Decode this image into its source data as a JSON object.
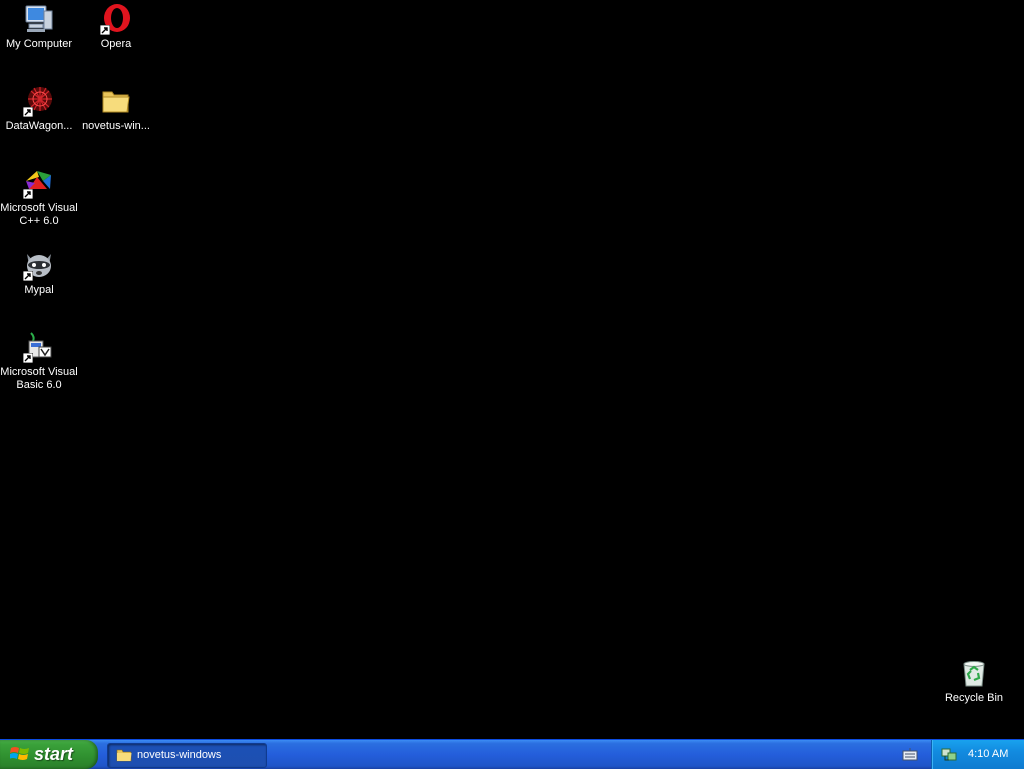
{
  "desktop": {
    "icons": [
      {
        "label": "My Computer",
        "icon": "my-computer-icon"
      },
      {
        "label": "Opera",
        "icon": "opera-icon"
      },
      {
        "label": "DataWagon...",
        "icon": "datawagon-icon"
      },
      {
        "label": "novetus-win...",
        "icon": "folder-icon"
      },
      {
        "label": "Microsoft Visual C++ 6.0",
        "icon": "visual-cpp-icon"
      },
      {
        "label": "Mypal",
        "icon": "mypal-icon"
      },
      {
        "label": "Microsoft Visual Basic 6.0",
        "icon": "visual-basic-icon"
      },
      {
        "label": "Recycle Bin",
        "icon": "recycle-bin-icon"
      }
    ]
  },
  "taskbar": {
    "start_label": "start",
    "task": {
      "label": "novetus-windows"
    },
    "clock": "4:10 AM"
  },
  "colors": {
    "desktop": "#000000",
    "taskbar": "#245edb",
    "start": "#3aa13a",
    "tray": "#128be0"
  }
}
